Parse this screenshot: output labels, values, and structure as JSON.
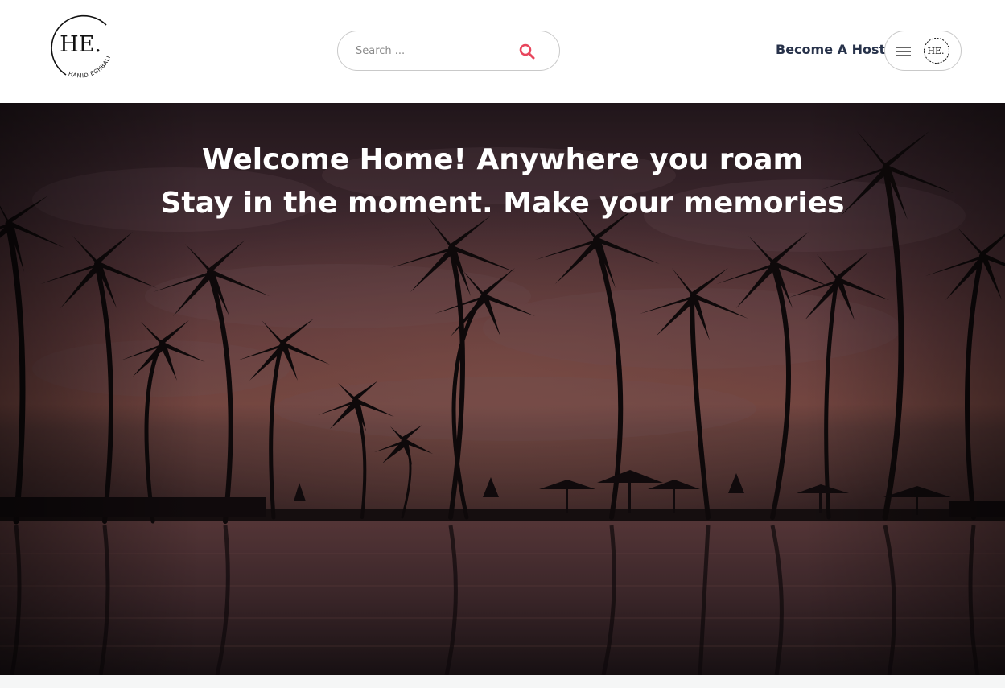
{
  "header": {
    "logo": {
      "monogram": "HE.",
      "name": "HAMID EGHBALI"
    },
    "search": {
      "placeholder": "Search ...",
      "value": "",
      "icon": "search-icon",
      "icon_color": "#e8455c"
    },
    "become_host_label": "Become A Host",
    "user_menu": {
      "menu_icon": "hamburger-menu-icon",
      "avatar_text": "HE."
    }
  },
  "hero": {
    "title_line1": "Welcome Home! Anywhere you roam",
    "title_line2": "Stay in the moment. Make your memories",
    "image": "tropical-sunset-palm-trees-pool"
  },
  "colors": {
    "text_dark": "#27324a",
    "accent": "#e8455c",
    "border": "#c9c9c9",
    "page_bg": "#f5f6f6"
  }
}
